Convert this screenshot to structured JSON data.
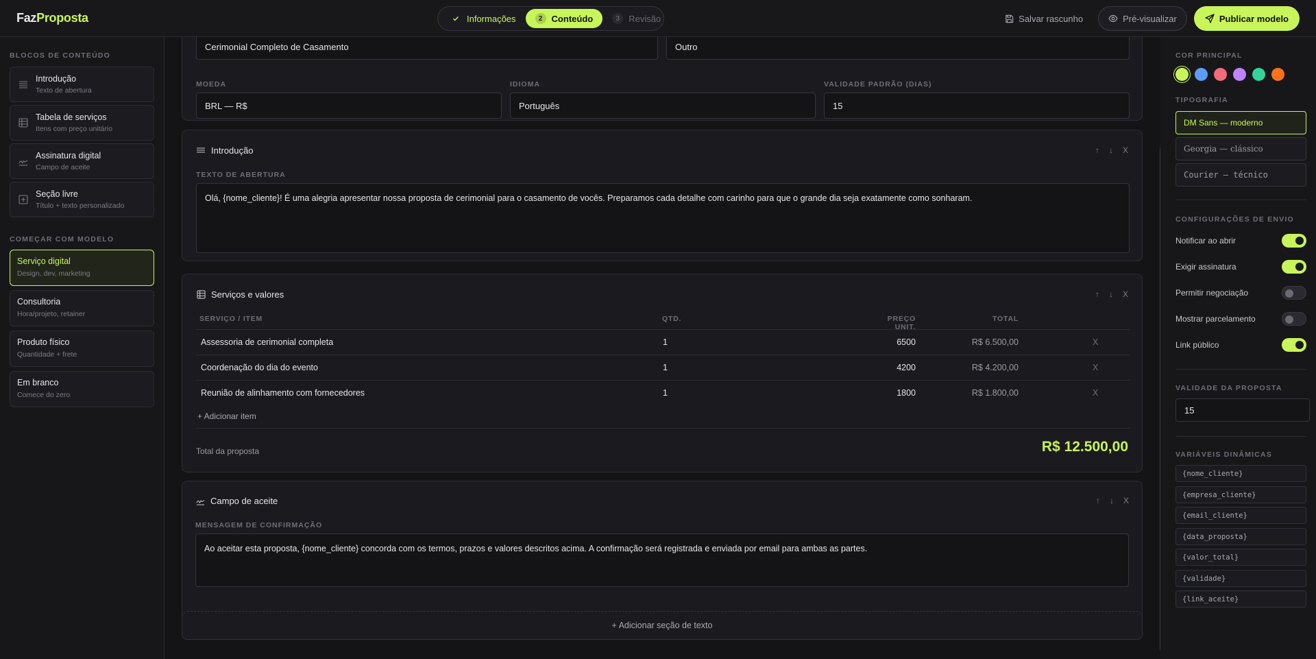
{
  "brand": {
    "part1": "Faz",
    "part2": "Proposta",
    "accent": "#c8f55a"
  },
  "steps": [
    {
      "num": "✓",
      "label": "Informações",
      "state": "done"
    },
    {
      "num": "2",
      "label": "Conteúdo",
      "state": "active"
    },
    {
      "num": "3",
      "label": "Revisão",
      "state": "todo"
    }
  ],
  "toolbar": {
    "save_label": "Salvar rascunho",
    "preview_label": "Pré-visualizar",
    "publish_label": "Publicar modelo"
  },
  "sidebar": {
    "blocks_title": "Blocos de conteúdo",
    "blocks": [
      {
        "title": "Introdução",
        "sub": "Texto de abertura",
        "icon": "lines-icon"
      },
      {
        "title": "Tabela de serviços",
        "sub": "Itens com preço unitário",
        "icon": "table-icon"
      },
      {
        "title": "Assinatura digital",
        "sub": "Campo de aceite",
        "icon": "signature-icon"
      },
      {
        "title": "Seção livre",
        "sub": "Título + texto personalizado",
        "icon": "plus-square-icon"
      }
    ],
    "templates_title": "Começar com modelo",
    "templates": [
      {
        "title": "Serviço digital",
        "sub": "Design, dev, marketing",
        "selected": true
      },
      {
        "title": "Consultoria",
        "sub": "Hora/projeto, retainer",
        "selected": false
      },
      {
        "title": "Produto físico",
        "sub": "Quantidade + frete",
        "selected": false
      },
      {
        "title": "Em branco",
        "sub": "Comece do zero",
        "selected": false
      }
    ]
  },
  "info": {
    "name_value": "Cerimonial Completo de Casamento",
    "category_value": "Outro",
    "currency_label": "Moeda",
    "currency_value": "BRL — R$",
    "language_label": "Idioma",
    "language_value": "Português",
    "validity_label": "Validade padrão (dias)",
    "validity_value": "15"
  },
  "intro": {
    "title": "Introdução",
    "field_label": "Texto de abertura",
    "text": "Olá, {nome_cliente}! É uma alegria apresentar nossa proposta de cerimonial para o casamento de vocês. Preparamos cada detalhe com carinho para que o grande dia seja exatamente como sonharam."
  },
  "services": {
    "title": "Serviços e valores",
    "headers": {
      "item": "Serviço / Item",
      "qty": "Qtd.",
      "price": "Preço unit.",
      "total": "Total"
    },
    "rows": [
      {
        "item": "Assessoria de cerimonial completa",
        "qty": "1",
        "price": "6500",
        "total": "R$ 6.500,00"
      },
      {
        "item": "Coordenação do dia do evento",
        "qty": "1",
        "price": "4200",
        "total": "R$ 4.200,00"
      },
      {
        "item": "Reunião de alinhamento com fornecedores",
        "qty": "1",
        "price": "1800",
        "total": "R$ 1.800,00"
      }
    ],
    "add_item": "+ Adicionar item",
    "total_label": "Total da proposta",
    "total_value": "R$ 12.500,00"
  },
  "accept": {
    "title": "Campo de aceite",
    "field_label": "Mensagem de confirmação",
    "text": "Ao aceitar esta proposta, {nome_cliente} concorda com os termos, prazos e valores descritos acima. A confirmação será registrada e enviada por email para ambas as partes."
  },
  "add_section": "+ Adicionar seção de texto",
  "controls": {
    "up": "↑",
    "down": "↓",
    "remove": "X"
  },
  "right": {
    "color_title": "Cor principal",
    "colors": [
      "#c8f55a",
      "#5b9cf5",
      "#f26b7a",
      "#c084fc",
      "#34d399",
      "#f97316"
    ],
    "typo_title": "Tipografia",
    "fonts": [
      {
        "label": "DM Sans — moderno",
        "selected": true
      },
      {
        "label": "Georgia — clássico",
        "selected": false
      },
      {
        "label": "Courier — técnico",
        "selected": false
      }
    ],
    "send_title": "Configurações de envio",
    "toggles": [
      {
        "label": "Notificar ao abrir",
        "on": true
      },
      {
        "label": "Exigir assinatura",
        "on": true
      },
      {
        "label": "Permitir negociação",
        "on": false
      },
      {
        "label": "Mostrar parcelamento",
        "on": false
      },
      {
        "label": "Link público",
        "on": true
      }
    ],
    "validity_title": "Validade da proposta",
    "validity_value": "15",
    "vars_title": "Variáveis dinâmicas",
    "vars": [
      "{nome_cliente}",
      "{empresa_cliente}",
      "{email_cliente}",
      "{data_proposta}",
      "{valor_total}",
      "{validade}",
      "{link_aceite}"
    ]
  }
}
